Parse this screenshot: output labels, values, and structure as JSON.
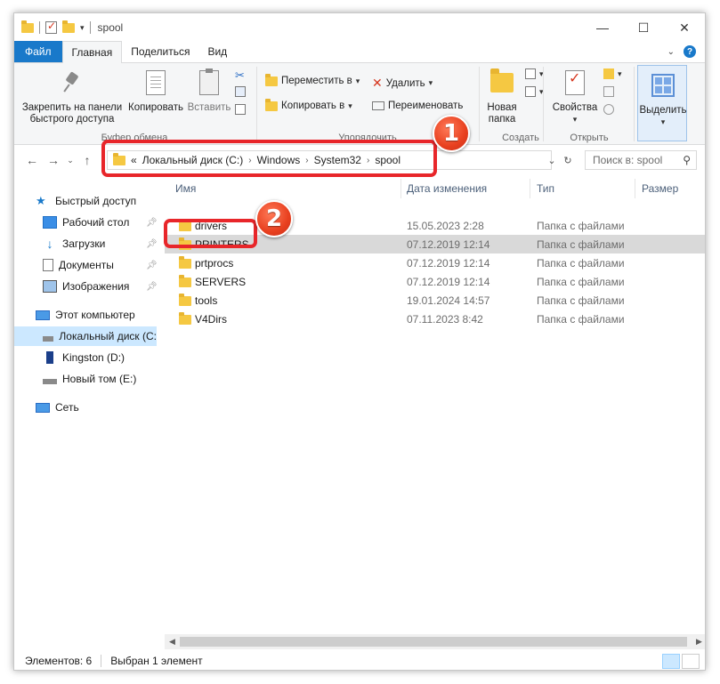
{
  "window": {
    "title": "spool",
    "controls": {
      "minimize": "—",
      "maximize": "☐",
      "close": "✕"
    }
  },
  "tabs": [
    {
      "label": "Файл"
    },
    {
      "label": "Главная"
    },
    {
      "label": "Поделиться"
    },
    {
      "label": "Вид"
    }
  ],
  "ribbon": {
    "clipboard": {
      "label": "Буфер обмена",
      "pin_line1": "Закрепить на панели",
      "pin_line2": "быстрого доступа",
      "copy": "Копировать",
      "paste": "Вставить"
    },
    "organize": {
      "label": "Упорядочить",
      "move_to": "Переместить в",
      "copy_to": "Копировать в",
      "delete": "Удалить",
      "rename": "Переименовать"
    },
    "create": {
      "label": "Создать",
      "new_folder_line1": "Новая",
      "new_folder_line2": "папка"
    },
    "open": {
      "label": "Открыть",
      "properties": "Свойства"
    },
    "select": {
      "label": "Выделить"
    }
  },
  "address": {
    "overflow": "«",
    "crumbs": [
      "Локальный диск (C:)",
      "Windows",
      "System32",
      "spool"
    ],
    "search_placeholder": "Поиск в: spool"
  },
  "navpane": {
    "items": [
      {
        "label": "Быстрый доступ",
        "icon": "star-icon"
      },
      {
        "label": "Рабочий стол",
        "icon": "desktop-icon"
      },
      {
        "label": "Загрузки",
        "icon": "download-icon"
      },
      {
        "label": "Документы",
        "icon": "documents-icon"
      },
      {
        "label": "Изображения",
        "icon": "pictures-icon"
      },
      {
        "label": "Этот компьютер",
        "icon": "computer-icon"
      },
      {
        "label": "Локальный диск (C:",
        "icon": "drive-icon"
      },
      {
        "label": "Kingston (D:)",
        "icon": "usb-drive-icon"
      },
      {
        "label": "Новый том (E:)",
        "icon": "drive-icon"
      },
      {
        "label": "Сеть",
        "icon": "network-icon"
      }
    ]
  },
  "filelist": {
    "columns": [
      "Имя",
      "Дата изменения",
      "Тип",
      "Размер"
    ],
    "rows": [
      {
        "name": "drivers",
        "date": "15.05.2023 2:28",
        "type": "Папка с файлами"
      },
      {
        "name": "PRINTERS",
        "date": "07.12.2019 12:14",
        "type": "Папка с файлами"
      },
      {
        "name": "prtprocs",
        "date": "07.12.2019 12:14",
        "type": "Папка с файлами"
      },
      {
        "name": "SERVERS",
        "date": "07.12.2019 12:14",
        "type": "Папка с файлами"
      },
      {
        "name": "tools",
        "date": "19.01.2024 14:57",
        "type": "Папка с файлами"
      },
      {
        "name": "V4Dirs",
        "date": "07.11.2023 8:42",
        "type": "Папка с файлами"
      }
    ]
  },
  "status": {
    "count": "Элементов: 6",
    "selected": "Выбран 1 элемент"
  },
  "callouts": {
    "one": "1",
    "two": "2"
  },
  "colors": {
    "accent": "#1979ca",
    "callout": "#e8262a",
    "selection": "#cce8ff"
  }
}
